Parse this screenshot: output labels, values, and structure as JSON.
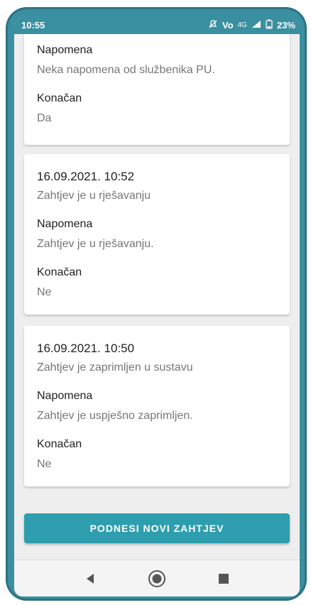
{
  "statusbar": {
    "time": "10:55",
    "battery": "23%",
    "network": "4G",
    "volte": "Vo"
  },
  "top_card": {
    "note_label": "Napomena",
    "note_text": "Neka napomena od službenika PU.",
    "final_label": "Konačan",
    "final_value": "Da"
  },
  "cards": [
    {
      "date": "16.09.2021. 10:52",
      "status": "Zahtjev je u rješavanju",
      "note_label": "Napomena",
      "note_text": "Zahtjev je u rješavanju.",
      "final_label": "Konačan",
      "final_value": "Ne"
    },
    {
      "date": "16.09.2021. 10:50",
      "status": "Zahtjev je zaprimljen u sustavu",
      "note_label": "Napomena",
      "note_text": "Zahtjev je uspješno zaprimljen.",
      "final_label": "Konačan",
      "final_value": "Ne"
    }
  ],
  "button": {
    "label": "PODNESI NOVI ZAHTJEV"
  },
  "colors": {
    "accent": "#2e9eaf",
    "frame": "#3a8fa0"
  }
}
